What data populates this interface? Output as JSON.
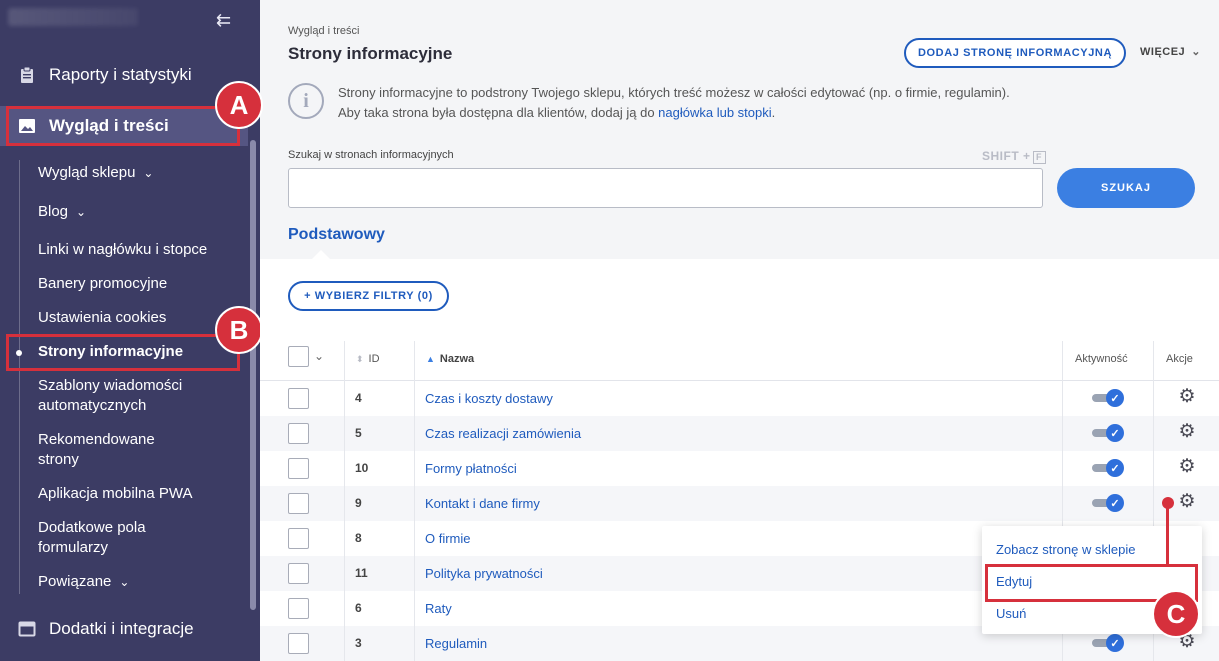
{
  "sidebar": {
    "top_items": [
      {
        "label": "Raporty i statystyki",
        "icon": "clipboard-icon"
      },
      {
        "label": "Wygląd i treści",
        "icon": "image-icon"
      },
      {
        "label": "Dodatki i integracje",
        "icon": "window-icon"
      }
    ],
    "sub_items": [
      {
        "label": "Wygląd sklepu",
        "chevron": "⌄"
      },
      {
        "label": "Blog",
        "chevron": "⌄"
      },
      {
        "label": "Linki w nagłówku i stopce"
      },
      {
        "label": "Banery promocyjne"
      },
      {
        "label": "Ustawienia cookies"
      },
      {
        "label": "Strony informacyjne"
      },
      {
        "label": "Szablony wiadomości automatycznych"
      },
      {
        "label": "Rekomendowane strony"
      },
      {
        "label": "Aplikacja mobilna PWA"
      },
      {
        "label": "Dodatkowe pola formularzy"
      },
      {
        "label": "Powiązane",
        "chevron": "⌄"
      }
    ],
    "sub_lines": {
      "s6a": "Szablony wiadomości",
      "s6b": "automatycznych",
      "s7a": "Rekomendowane",
      "s7b": "strony",
      "s9a": "Dodatkowe pola",
      "s9b": "formularzy"
    },
    "collapse_icon": "⇇"
  },
  "annotations": {
    "a": "A",
    "b": "B",
    "c": "C",
    "color": "#d6303c"
  },
  "header": {
    "breadcrumb": "Wygląd i treści",
    "title": "Strony informacyjne",
    "add_button": "DODAJ STRONĘ INFORMACYJNĄ",
    "more_button": "WIĘCEJ",
    "info_icon": "i",
    "info_line1": "Strony informacyjne to podstrony Twojego sklepu, których treść możesz w całości edytować (np. o firmie, regulamin).",
    "info_line2_prefix": "Aby taka strona była dostępna dla klientów, dodaj ją do ",
    "info_line2_link": "nagłówka lub stopki",
    "info_line2_suffix": "."
  },
  "search": {
    "label": "Szukaj w stronach informacyjnych",
    "shortcut": "SHIFT +",
    "shortcut_key": "F",
    "value": "",
    "button": "SZUKAJ"
  },
  "tab": {
    "label": "Podstawowy"
  },
  "filters": {
    "button": "+ WYBIERZ FILTRY (0)"
  },
  "table": {
    "columns": {
      "id": "ID",
      "name": "Nazwa",
      "active": "Aktywność",
      "actions": "Akcje"
    },
    "rows": [
      {
        "id": "4",
        "name": "Czas i koszty dostawy",
        "active": true
      },
      {
        "id": "5",
        "name": "Czas realizacji zamówienia",
        "active": true
      },
      {
        "id": "10",
        "name": "Formy płatności",
        "active": true
      },
      {
        "id": "9",
        "name": "Kontakt i dane firmy",
        "active": true
      },
      {
        "id": "8",
        "name": "O firmie",
        "active": true
      },
      {
        "id": "11",
        "name": "Polityka prywatności",
        "active": true
      },
      {
        "id": "6",
        "name": "Raty",
        "active": true
      },
      {
        "id": "3",
        "name": "Regulamin",
        "active": true
      }
    ]
  },
  "action_menu": {
    "items": [
      "Zobacz stronę w sklepie",
      "Edytuj",
      "Usuń"
    ]
  },
  "colors": {
    "sidebar": "#3c3c64",
    "accent": "#1f5bbd",
    "annotation": "#d6303c",
    "toggle_on": "#2f6fdb"
  }
}
